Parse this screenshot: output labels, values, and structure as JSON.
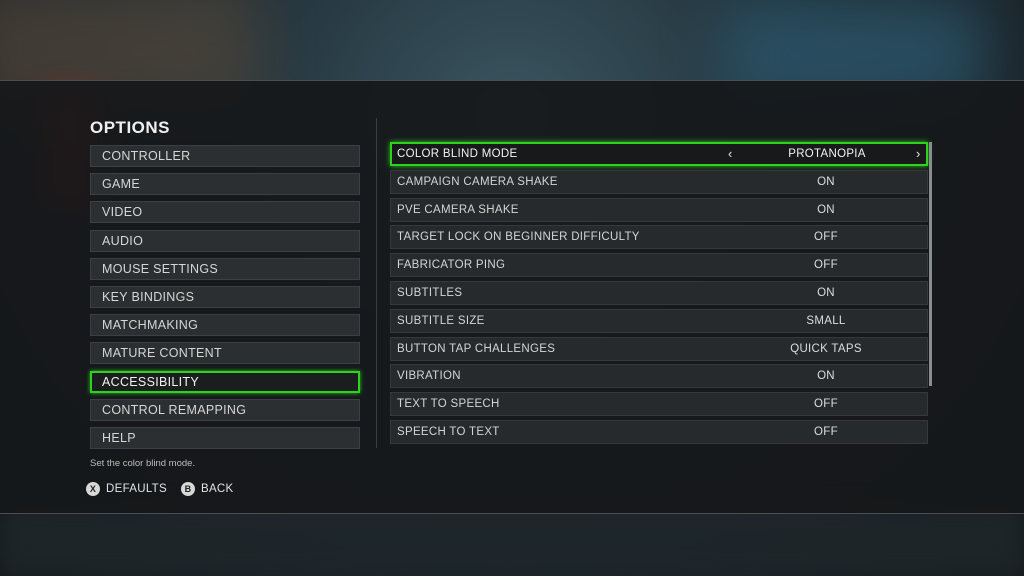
{
  "title": "OPTIONS",
  "menu": {
    "items": [
      {
        "label": "CONTROLLER"
      },
      {
        "label": "GAME"
      },
      {
        "label": "VIDEO"
      },
      {
        "label": "AUDIO"
      },
      {
        "label": "MOUSE SETTINGS"
      },
      {
        "label": "KEY BINDINGS"
      },
      {
        "label": "MATCHMAKING"
      },
      {
        "label": "MATURE CONTENT"
      },
      {
        "label": "ACCESSIBILITY"
      },
      {
        "label": "CONTROL REMAPPING"
      },
      {
        "label": "HELP"
      }
    ],
    "selected": "ACCESSIBILITY"
  },
  "settings": [
    {
      "label": "COLOR BLIND MODE",
      "value": "PROTANOPIA"
    },
    {
      "label": "CAMPAIGN CAMERA SHAKE",
      "value": "ON"
    },
    {
      "label": "PVE CAMERA SHAKE",
      "value": "ON"
    },
    {
      "label": "TARGET LOCK ON BEGINNER DIFFICULTY",
      "value": "OFF"
    },
    {
      "label": "FABRICATOR PING",
      "value": "OFF"
    },
    {
      "label": "SUBTITLES",
      "value": "ON"
    },
    {
      "label": "SUBTITLE SIZE",
      "value": "SMALL"
    },
    {
      "label": "BUTTON TAP CHALLENGES",
      "value": "QUICK TAPS"
    },
    {
      "label": "VIBRATION",
      "value": "ON"
    },
    {
      "label": "TEXT TO SPEECH",
      "value": "OFF"
    },
    {
      "label": "SPEECH TO TEXT",
      "value": "OFF"
    }
  ],
  "arrows": {
    "left": "‹",
    "right": "›"
  },
  "hint": "Set the color blind mode.",
  "footer": {
    "defaults": {
      "glyph": "X",
      "label": "DEFAULTS"
    },
    "back": {
      "glyph": "B",
      "label": "BACK"
    }
  },
  "colors": {
    "accent": "#2fd11f"
  }
}
